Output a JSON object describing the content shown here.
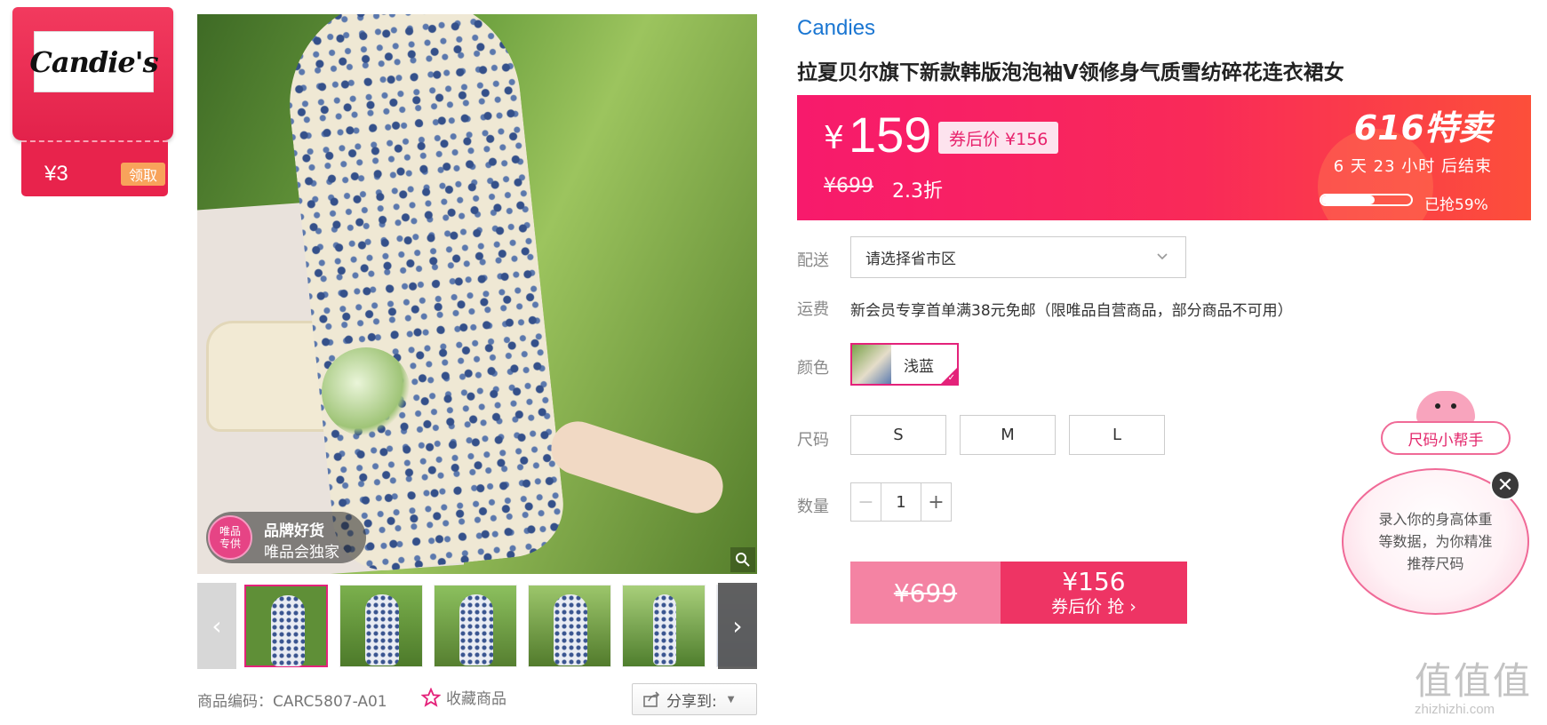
{
  "brand_card": {
    "logo_text": "Candie's",
    "coupon_amount": "¥3",
    "claim_label": "领取"
  },
  "image_badge": {
    "seal_text": "唯品\n专供",
    "title": "品牌好货",
    "subtitle": "唯品会独家"
  },
  "thumbnails": {
    "count": 6,
    "selected_index": 0
  },
  "footer": {
    "sku_label": "商品编码：CARC5807-A01",
    "favorite_label": "收藏商品",
    "share_label": "分享到:"
  },
  "product": {
    "brand": "Candies",
    "title": "拉夏贝尔旗下新款韩版泡泡袖V领修身气质雪纺碎花连衣裙女"
  },
  "price_panel": {
    "currency": "¥",
    "price": "159",
    "coupon_price_label": "券后价 ¥156",
    "original_price": "¥699",
    "discount": "2.3折",
    "event_label": "616特卖",
    "countdown": "6 天 23 小时 后结束",
    "sold_fraction": 0.59,
    "sold_label": "已抢59%"
  },
  "delivery": {
    "label": "配送",
    "placeholder": "请选择省市区"
  },
  "shipping": {
    "label": "运费",
    "text": "新会员专享首单满38元免邮（限唯品自营商品，部分商品不可用）"
  },
  "color": {
    "label": "颜色",
    "options": [
      {
        "name": "浅蓝",
        "selected": true
      }
    ]
  },
  "size": {
    "label": "尺码",
    "options": [
      "S",
      "M",
      "L"
    ]
  },
  "quantity": {
    "label": "数量",
    "value": "1",
    "minus": "−",
    "plus": "+"
  },
  "buy_button": {
    "original_price": "¥699",
    "coupon_price": "¥156",
    "action_label": "券后价 抢 ›"
  },
  "size_helper": {
    "label": "尺码小帮手",
    "bubble_text": "录入你的身高体重等数据，为你精准推荐尺码",
    "close": "✕"
  },
  "watermark": {
    "logo": "值值值",
    "url": "zhizhizhi.com"
  },
  "colors": {
    "accent_pink": "#e4227a",
    "price_panel_start": "#f71a6c",
    "price_panel_end": "#fc4f3a",
    "brand_blue": "#1a76d2"
  }
}
